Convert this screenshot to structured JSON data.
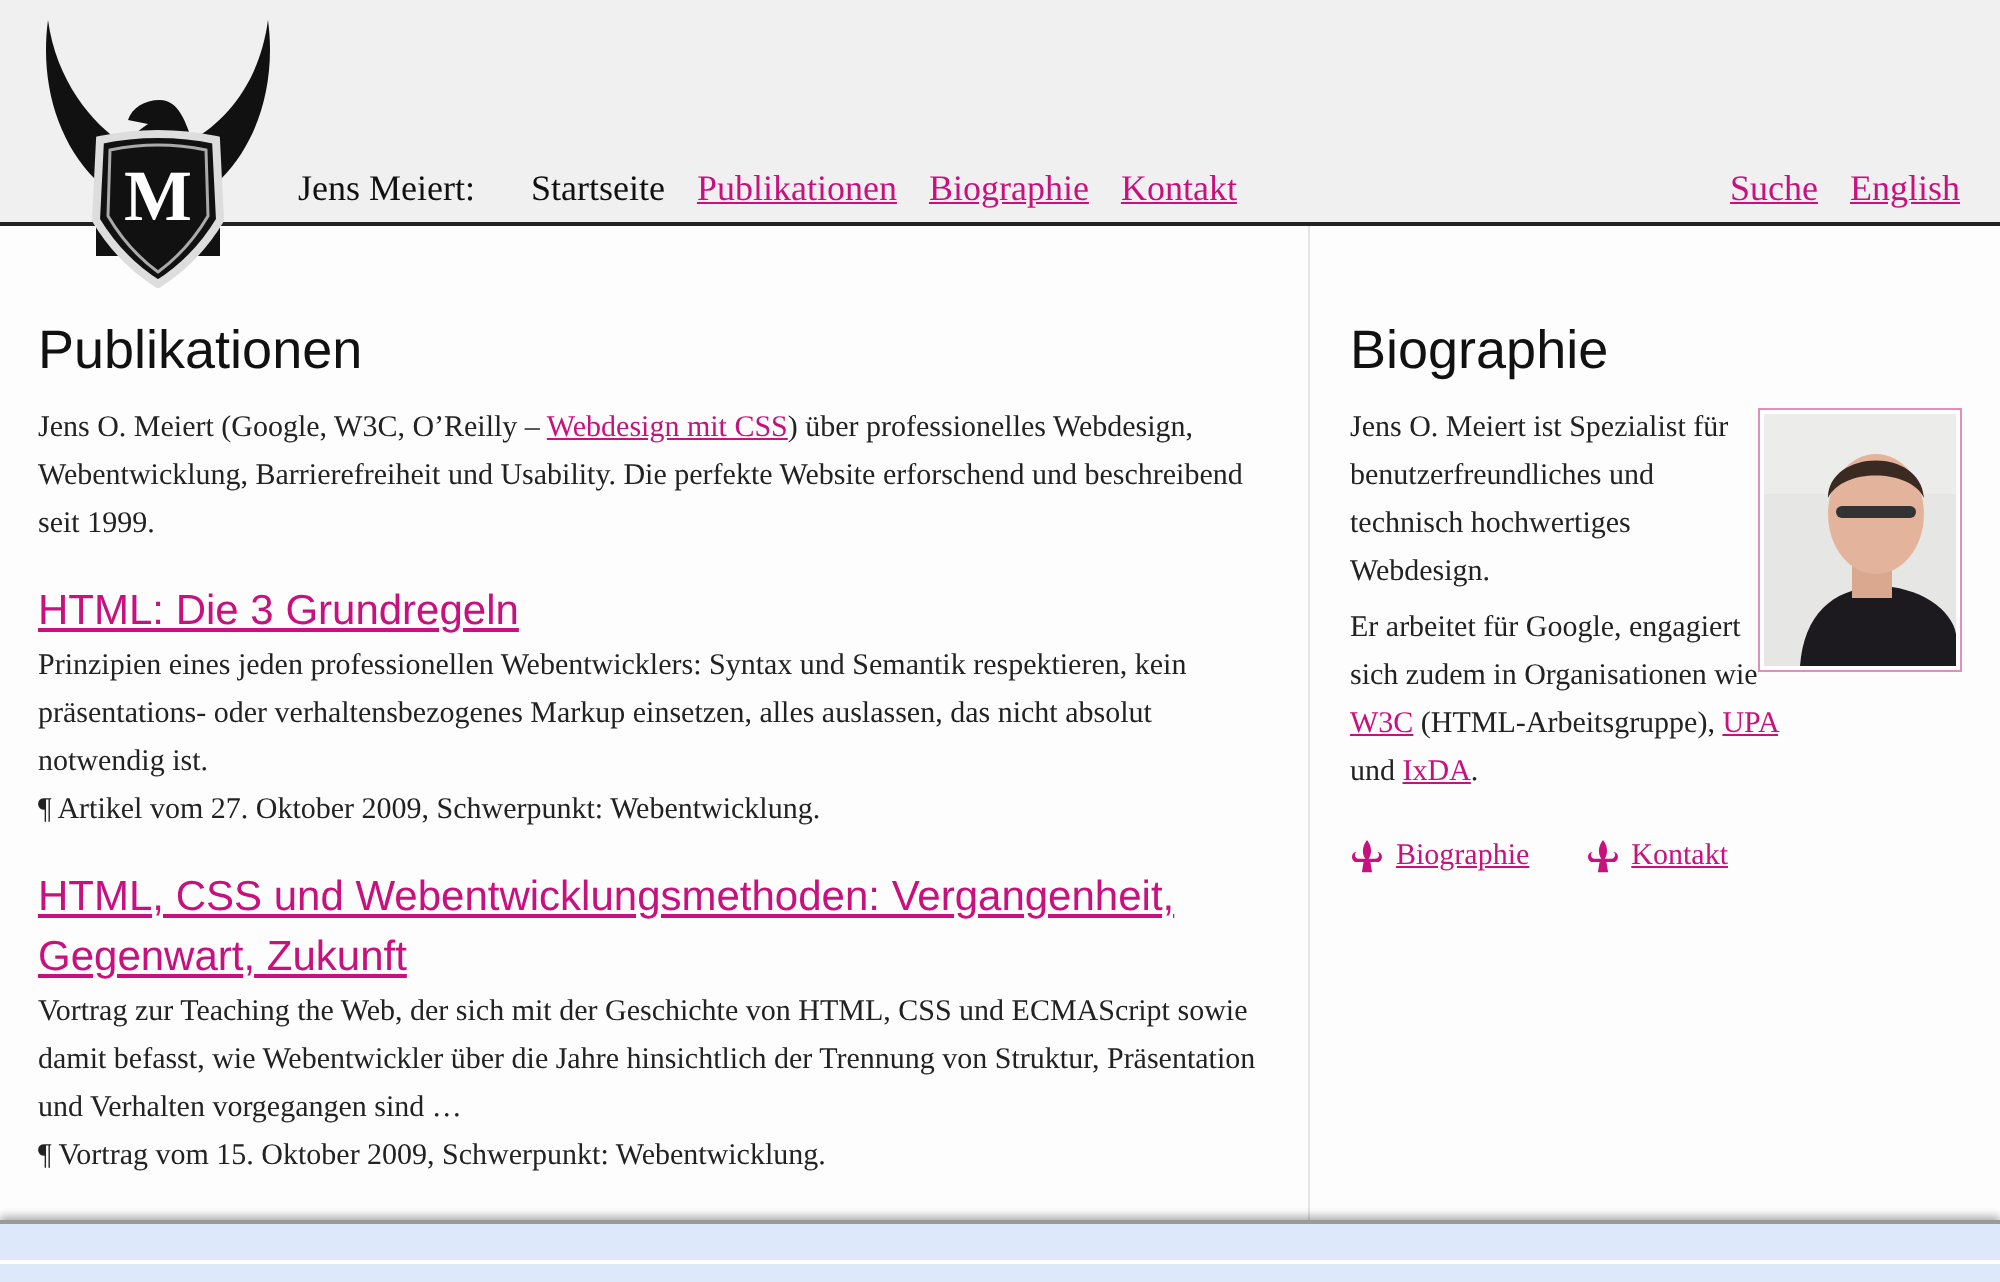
{
  "header": {
    "logo_letter": "M",
    "site_name": "Jens Meiert:",
    "nav": [
      {
        "label": "Startseite",
        "selected": true
      },
      {
        "label": "Publikationen",
        "selected": false
      },
      {
        "label": "Biographie",
        "selected": false
      },
      {
        "label": "Kontakt",
        "selected": false
      }
    ],
    "nav_right": [
      "Suche",
      "English"
    ]
  },
  "main": {
    "title": "Publikationen",
    "intro": [
      {
        "kind": "text",
        "text": "Jens O. Meiert (Google, W3C, O’Reilly – "
      },
      {
        "kind": "link",
        "text": "Webdesign mit CSS"
      },
      {
        "kind": "text",
        "text": ") über professionelles Webdesign, Webentwicklung, Barrierefreiheit und Usability. Die perfekte Website erforschend und beschreibend seit 1999."
      }
    ],
    "articles": [
      {
        "title": "HTML: Die 3 Grundregeln",
        "summary": "Prinzipien eines jeden professionellen Webentwicklers: Syntax und Semantik respektieren, kein präsentations- oder verhaltensbezogenes Markup einsetzen, alles auslassen, das nicht absolut notwendig ist.",
        "meta": "¶ Artikel vom 27. Oktober 2009, Schwerpunkt: Webentwicklung."
      },
      {
        "title": "HTML, CSS und Webentwicklungsmethoden: Vergangenheit, Gegenwart, Zukunft",
        "summary": "Vortrag zur Teaching the Web, der sich mit der Geschichte von HTML, CSS und ECMAScript sowie damit befasst, wie Webentwickler über die Jahre hinsichtlich der Trennung von Struktur, Präsentation und Verhalten vorgegangen sind …",
        "meta": "¶ Vortrag vom 15. Oktober 2009, Schwerpunkt: Webentwicklung."
      }
    ]
  },
  "sidebar": {
    "title": "Biographie",
    "photo": {
      "kind": "picture"
    },
    "paragraphs": [
      [
        {
          "kind": "text",
          "text": "Jens O. Meiert ist Spezialist für benutzerfreundliches und technisch hochwertiges Webdesign."
        }
      ],
      [
        {
          "kind": "text",
          "text": "Er arbeitet für Google, engagiert sich zudem in Organisationen wie "
        },
        {
          "kind": "link",
          "text": "W3C"
        },
        {
          "kind": "text",
          "text": " (HTML-Arbeitsgruppe), "
        },
        {
          "kind": "link",
          "text": "UPA"
        },
        {
          "kind": "text",
          "text": " und "
        },
        {
          "kind": "link",
          "text": "IxDA"
        },
        {
          "kind": "text",
          "text": "."
        }
      ]
    ],
    "links": [
      "Biographie",
      "Kontakt"
    ]
  }
}
